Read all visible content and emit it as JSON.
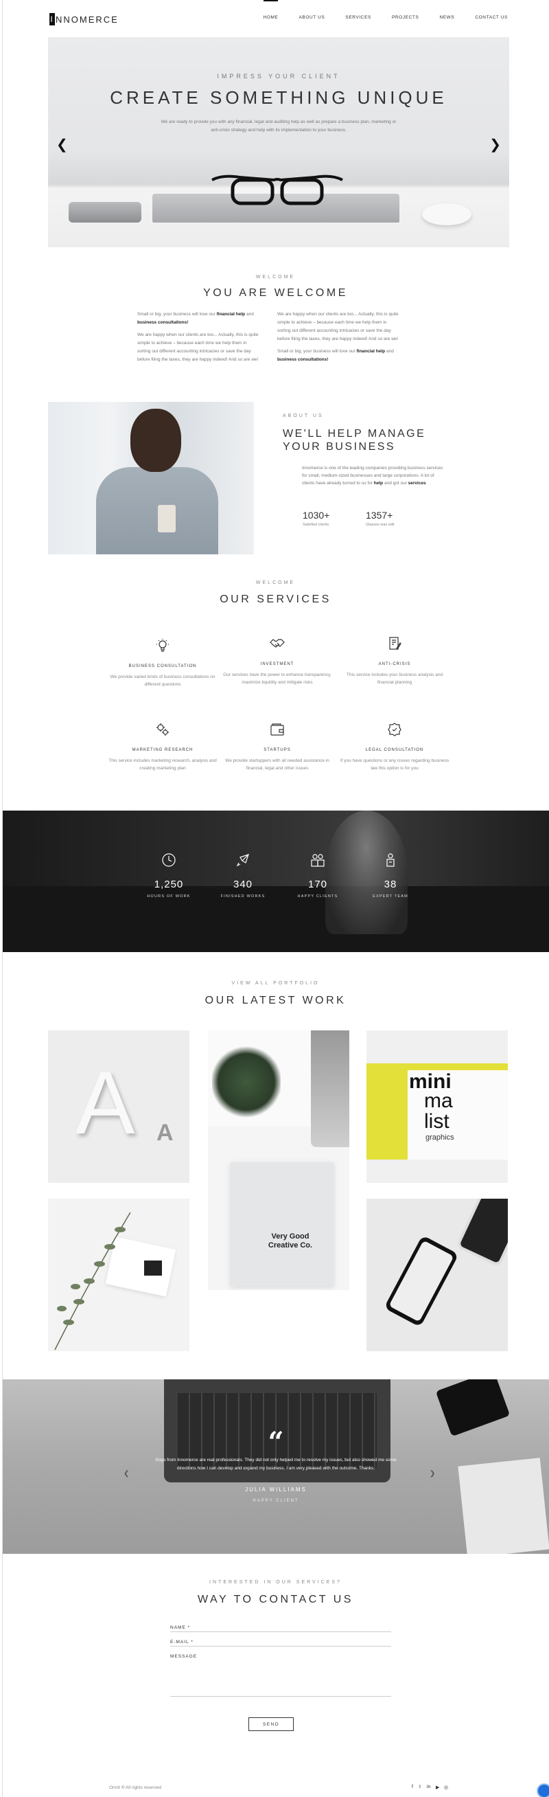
{
  "brand": {
    "logo_mark": "I",
    "logo_rest": "NNOMERCE"
  },
  "nav": {
    "items": [
      "HOME",
      "ABOUT US",
      "SERVICES",
      "PROJECTS",
      "NEWS",
      "CONTACT US"
    ],
    "active": "HOME"
  },
  "hero": {
    "eyebrow": "IMPRESS YOUR CLIENT",
    "title": "CREATE SOMETHING UNIQUE",
    "text": "We are ready to provide you with any financial, legal and auditing help as well as prepare a business plan, marketing or anti-crisis strategy and help with its implementation to your business."
  },
  "welcome": {
    "eyebrow": "WELCOME",
    "title": "YOU ARE WELCOME",
    "col1_p1_a": "Small or big, your business will love our ",
    "col1_p1_b": "financial help",
    "col1_p1_c": " and ",
    "col1_p1_d": "business consultations!",
    "col1_p2": "We are happy when our clients are too... Actually, this is quite simple to achieve – because each time we help them in sorting out different accounting intricacies or save the day before filing the taxes, they are happy indeed! And so are we!",
    "col2_p1": "We are happy when our clients are too... Actually, this is quite simple to achieve – because each time we help them in sorting out different accounting intricacies or save the day before filing the taxes, they are happy indeed! And so are we!",
    "col2_p2_a": "Small or big, your business will love our ",
    "col2_p2_b": "financial help",
    "col2_p2_c": " and ",
    "col2_p2_d": "business consultations!"
  },
  "about": {
    "eyebrow": "ABOUT US",
    "title_line1": "WE'LL HELP MANAGE",
    "title_line2": "YOUR BUSINESS",
    "text_a": "Innomerce is one of the leading companies providing business services for small, medium-sized businesses and large corporations. A lot of clients have already turned to us for ",
    "text_b": "help",
    "text_c": " and got our ",
    "text_d": "services",
    "stats": [
      {
        "number": "1030+",
        "label": "Satisfied clients"
      },
      {
        "number": "1357+",
        "label": "Glasses was edit"
      }
    ]
  },
  "services": {
    "eyebrow": "WELCOME",
    "title": "OUR SERVICES",
    "items": [
      {
        "icon": "lightbulb-icon",
        "title": "BUSINESS CONSULTATION",
        "text": "We provide varied kinds of business consultations on different questions"
      },
      {
        "icon": "handshake-icon",
        "title": "INVESTMENT",
        "text": "Our services have the power to enhance transparency, maximize liquidity and mitigate risks"
      },
      {
        "icon": "document-pen-icon",
        "title": "ANTI-CRISIS",
        "text": "This service includes your business analysis and financial planning"
      },
      {
        "icon": "gears-icon",
        "title": "MARKETING RESEARCH",
        "text": "This service includes marketing research, analysis and creating marketing plan"
      },
      {
        "icon": "wallet-icon",
        "title": "STARTUPS",
        "text": "We provide startuppers with all needed assistance in financial, legal and other issues"
      },
      {
        "icon": "legal-badge-icon",
        "title": "LEGAL CONSULTATION",
        "text": "If you have questions or any issues regarding business law this option is for you"
      }
    ]
  },
  "counters": [
    {
      "icon": "clock-icon",
      "number": "1,250",
      "label": "HOURS OF WORK"
    },
    {
      "icon": "rocket-icon",
      "number": "340",
      "label": "FINISHED WORKS"
    },
    {
      "icon": "team-icon",
      "number": "170",
      "label": "HAPPY CLIENTS"
    },
    {
      "icon": "expert-icon",
      "number": "38",
      "label": "EXPERT TEAM"
    }
  ],
  "portfolio": {
    "eyebrow": "VIEW ALL PORTFOLIO",
    "title": "OUR LATEST WORK",
    "tile_texts": {
      "mini1": "mini",
      "mini2": "ma",
      "mini3": "list",
      "mini4": "graphics",
      "vg1": "Very Good",
      "vg2": "Creative Co."
    }
  },
  "testimonial": {
    "quote": "Guys from Innomerce are real professionals. They did not only helped me to resolve my issues, but also showed me some directions how I can develop and expand my business. I am very pleased with the outcome. Thanks.",
    "name": "JULIA WILLIAMS",
    "role": "HAPPY CLIENT"
  },
  "contact": {
    "eyebrow": "INTERESTED IN OUR SERVICES?",
    "title": "WAY TO CONTACT US",
    "name_placeholder": "NAME *",
    "email_placeholder": "E-MAIL *",
    "message_placeholder": "MESSAGE",
    "send_label": "SEND"
  },
  "footer": {
    "copyright": "Ormit ® All rights reserved",
    "social": [
      "f",
      "t",
      "in",
      "▶",
      "◎"
    ]
  },
  "colors": {
    "text": "#333333",
    "muted": "#888888",
    "accent_chat": "#1e6fd9"
  }
}
